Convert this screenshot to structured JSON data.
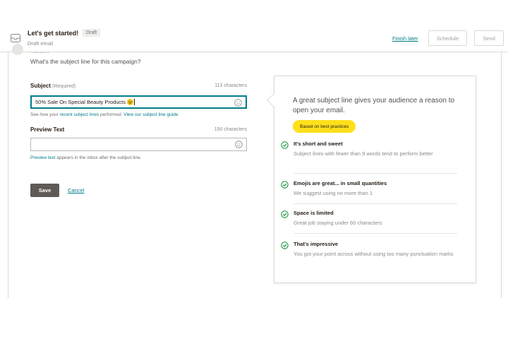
{
  "header": {
    "title": "Let's get started!",
    "badge": "Draft",
    "subtitle": "Draft email",
    "finish_later": "Finish later",
    "schedule": "Schedule",
    "send": "Send"
  },
  "section": {
    "heading": "Subject",
    "question": "What's the subject line for this campaign?"
  },
  "subject": {
    "label": "Subject",
    "required": "(Required)",
    "char_count": "113 characters",
    "value": "50% Sale On Special Beauty Products",
    "helper_prefix": "See how your ",
    "helper_link1": "recent subject lines",
    "helper_mid": " performed. ",
    "helper_link2": "View our subject line guide"
  },
  "preview": {
    "label": "Preview Text",
    "char_count": "150 characters",
    "value": "",
    "helper_link": "Preview text",
    "helper_rest": " appears in the inbox after the subject line."
  },
  "actions": {
    "save": "Save",
    "cancel": "Cancel"
  },
  "tips": {
    "title": "A great subject line gives your audience a reason to open your email.",
    "badge": "Based on best practices",
    "items": [
      {
        "head": "It's short and sweet",
        "body": "Subject lines with fewer than 9 words tend to perform better"
      },
      {
        "head": "Emojis are great... in small quantities",
        "body": "We suggest using no more than 1"
      },
      {
        "head": "Space is limited",
        "body": "Great job staying under 60 characters"
      },
      {
        "head": "That's impressive",
        "body": "You got your point across without using too many punctuation marks"
      }
    ]
  },
  "colors": {
    "accent": "#007c89",
    "badge_yellow": "#ffe01b",
    "check_green": "#00892b",
    "save_bg": "#5f5a56"
  },
  "icons": {
    "header": "envelope-icon",
    "input": "smiley-icon",
    "tip": "check-circle-icon",
    "emoji": "grinning-emoji"
  }
}
